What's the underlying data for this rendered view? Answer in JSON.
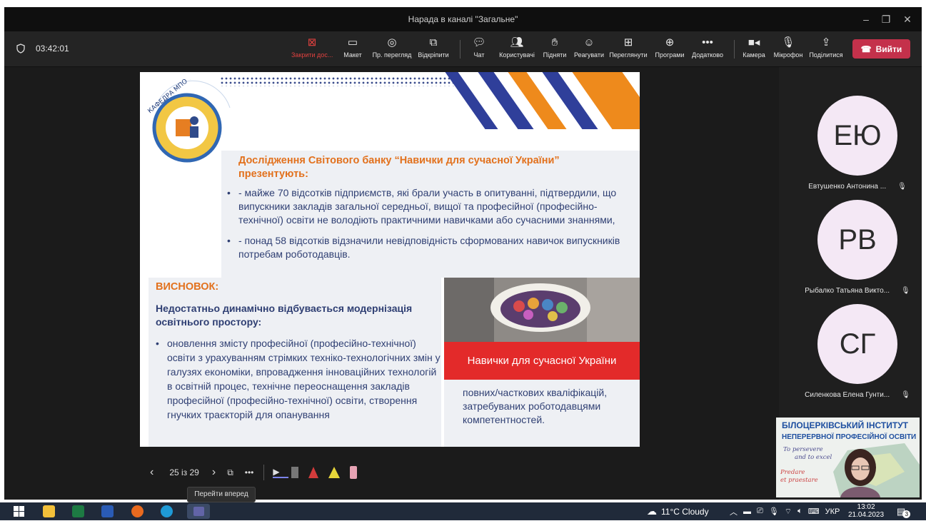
{
  "window": {
    "title": "Нарада в каналі \"Загальне\""
  },
  "toolbar": {
    "timer": "03:42:01",
    "buttons": [
      {
        "label": "Закрити дос...",
        "icon": "close-share-icon"
      },
      {
        "label": "Макет",
        "icon": "layout-icon"
      },
      {
        "label": "Пр. перегляд",
        "icon": "eye-icon"
      },
      {
        "label": "Відкріпити",
        "icon": "popout-icon"
      },
      {
        "label": "Чат",
        "icon": "chat-icon"
      },
      {
        "label": "Користувачі",
        "icon": "people-icon"
      },
      {
        "label": "Підняти",
        "icon": "raise-hand-icon"
      },
      {
        "label": "Реагувати",
        "icon": "smiley-icon"
      },
      {
        "label": "Переглянути",
        "icon": "rooms-icon"
      },
      {
        "label": "Програми",
        "icon": "apps-icon"
      },
      {
        "label": "Додатково",
        "icon": "more-icon"
      },
      {
        "label": "Камера",
        "icon": "camera-icon"
      },
      {
        "label": "Мікрофон",
        "icon": "mic-icon"
      },
      {
        "label": "Поділитися",
        "icon": "share-icon"
      }
    ],
    "leave_label": "Вийти"
  },
  "slide": {
    "logo_text": "КАФЕДРА МПО ТА СГД БІНПО",
    "heading": "Дослідження Світового банку “Навички для сучасної України” презентують:",
    "bullets": [
      "- майже 70 відсотків підприємств, які брали участь в опитуванні, підтвердили, що випускники закладів загальної середньої, вищої та професійної (професійно-технічної) освіти не володіють практичними навичками або сучасними знаннями,",
      "- понад 58 відсотків відзначили невідповідність сформованих навичок випускників потребам роботодавців."
    ],
    "conclusion_title": "ВИСНОВОК:",
    "conclusion_subtitle": "Недостатньо динамічно відбувається модернізація освітнього простору:",
    "conclusion_bullet": "оновлення змісту професійної (професійно-технічної) освіти з урахуванням стрімких техніко-технологічних змін у галузях економіки, впровадження інноваційних технологій в освітній процес, технічне переоснащення закладів професійної (професійно-технічної) освіти, створення гнучких траєкторій для опанування",
    "red_band_text": "Навички для сучасної України",
    "continuation": "повних/часткових кваліфікацій, затребуваних роботодавцями компетентностей."
  },
  "slide_controls": {
    "page": "25 із 29",
    "tooltip": "Перейти вперед"
  },
  "participants": [
    {
      "initials": "ЕЮ",
      "name": "Евтушенко Антонина ..."
    },
    {
      "initials": "РВ",
      "name": "Рыбалко Татьяна Викто..."
    },
    {
      "initials": "СГ",
      "name": "Силенкова Елена Гунти..."
    }
  ],
  "video": {
    "line1": "БІЛОЦЕРКІВСЬКИЙ ІНСТИТУТ",
    "line2": "НЕПЕРЕРВНОЇ ПРОФЕСІЙНОЇ ОСВІТИ",
    "hand1": "To persevere",
    "hand2": "and to excel",
    "hand3": "Predare",
    "hand4": "et praestare"
  },
  "taskbar": {
    "weather": "11°C  Cloudy",
    "lang": "УКР",
    "time": "13:02",
    "date": "21.04.2023",
    "notif": "3"
  },
  "colors": {
    "accent_orange": "#e2711d",
    "navy": "#2f3f73",
    "leave_red": "#c4314b",
    "band_red": "#e32a2a"
  }
}
